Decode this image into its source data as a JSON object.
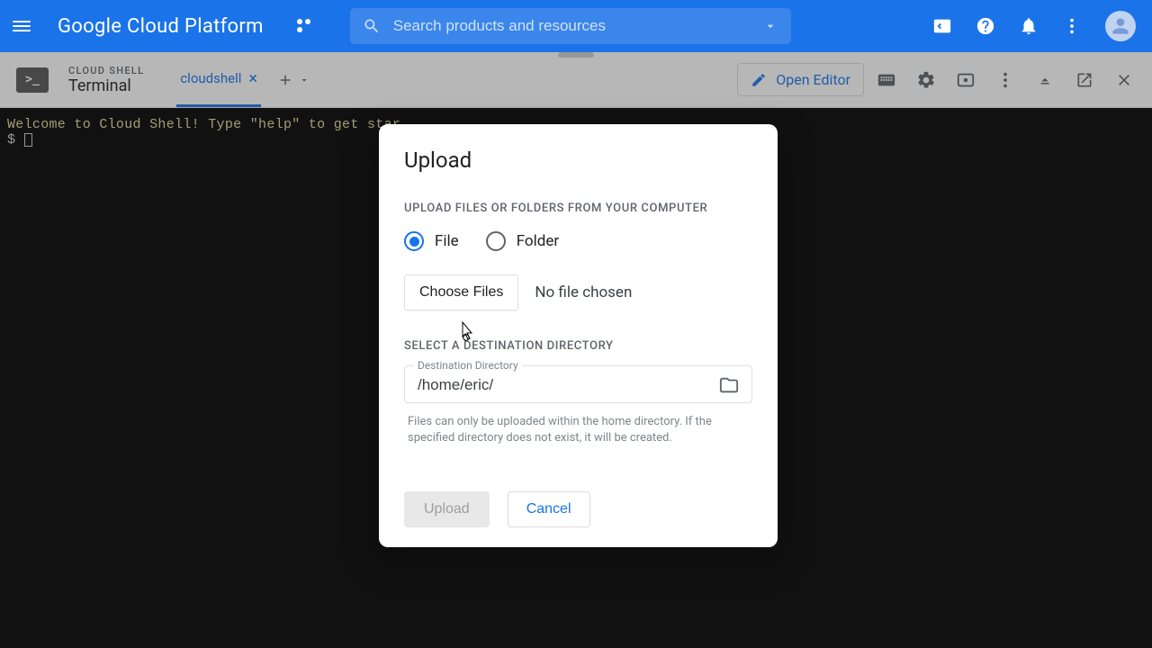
{
  "header": {
    "brand": "Google Cloud Platform",
    "search_placeholder": "Search products and resources"
  },
  "shell_header": {
    "eyebrow": "CLOUD SHELL",
    "title": "Terminal",
    "tab_label": "cloudshell",
    "open_editor": "Open Editor"
  },
  "terminal": {
    "welcome": "Welcome to Cloud Shell! Type \"help\" to get star",
    "prompt": "$"
  },
  "modal": {
    "title": "Upload",
    "section1": "UPLOAD FILES OR FOLDERS FROM YOUR COMPUTER",
    "radio_file": "File",
    "radio_folder": "Folder",
    "choose_files": "Choose Files",
    "no_file_chosen": "No file chosen",
    "section2": "SELECT A DESTINATION DIRECTORY",
    "dest_label": "Destination Directory",
    "dest_value": "/home/eric/",
    "helper": "Files can only be uploaded within the home directory. If the specified directory does not exist, it will be created.",
    "upload_btn": "Upload",
    "cancel_btn": "Cancel"
  }
}
